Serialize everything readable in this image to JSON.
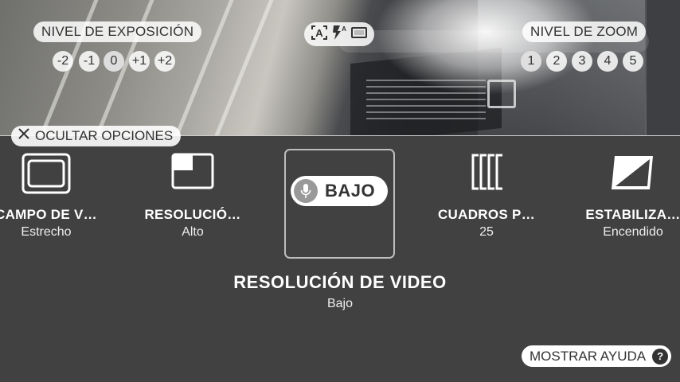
{
  "exposure": {
    "label": "NIVEL DE EXPOSICIÓN",
    "levels": [
      "-2",
      "-1",
      "0",
      "+1",
      "+2"
    ],
    "selected": "0"
  },
  "mode_icons": [
    "auto-exposure-icon",
    "flash-auto-icon",
    "aspect-ratio-icon"
  ],
  "zoom": {
    "label": "NIVEL DE ZOOM",
    "levels": [
      "1",
      "2",
      "3",
      "4",
      "5"
    ],
    "selected": "1"
  },
  "hide_options_label": "OCULTAR OPCIONES",
  "options": [
    {
      "icon": "field-of-view-icon",
      "title": "CAMPO DE V…",
      "value": "Estrecho"
    },
    {
      "icon": "resolution-icon",
      "title": "RESOLUCIÓ…",
      "value": "Alto"
    },
    {
      "icon": "frame-rate-icon",
      "title": "CUADROS P…",
      "value": "25"
    },
    {
      "icon": "stabilization-icon",
      "title": "ESTABILIZA…",
      "value": "Encendido"
    }
  ],
  "selected_option": {
    "icon": "microphone-icon",
    "pill_label": "BAJO",
    "title": "RESOLUCIÓN DE VIDEO",
    "value": "Bajo"
  },
  "help_label": "MOSTRAR AYUDA",
  "help_icon": "question-icon"
}
